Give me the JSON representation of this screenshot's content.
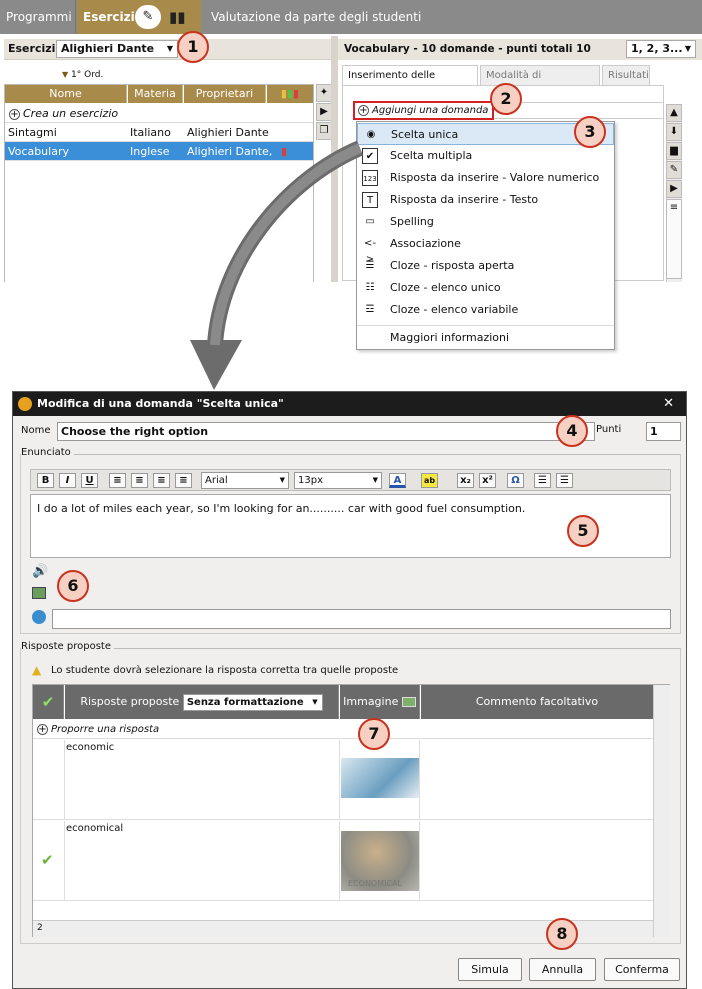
{
  "topbar": {
    "programmi": "Programmi",
    "esercizi": "Esercizi",
    "valutazione": "Valutazione da parte degli studenti"
  },
  "left": {
    "label": "Esercizi",
    "teacher": "Alighieri Dante",
    "level": "1° Ord.",
    "columns": [
      "Nome",
      "Materia",
      "Proprietari"
    ],
    "create": "Crea un esercizio",
    "rows": [
      {
        "nome": "Sintagmi",
        "materia": "Italiano",
        "proprietari": "Alighieri Dante"
      },
      {
        "nome": "Vocabulary",
        "materia": "Inglese",
        "proprietari": "Alighieri Dante,"
      }
    ]
  },
  "right": {
    "title": "Vocabulary - 10 domande - punti totali 10",
    "range": "1, 2, 3...",
    "tabs": [
      "Inserimento delle domande",
      "Modalità di esecuzione",
      "Risultati"
    ],
    "add": "Aggiungi una domanda",
    "menu": [
      "Scelta unica",
      "Scelta multipla",
      "Risposta da inserire - Valore numerico",
      "Risposta da inserire - Testo",
      "Spelling",
      "Associazione",
      "Cloze - risposta aperta",
      "Cloze - elenco unico",
      "Cloze - elenco variabile",
      "Maggiori informazioni"
    ]
  },
  "callouts": [
    "1",
    "2",
    "3",
    "4",
    "5",
    "6",
    "7",
    "8"
  ],
  "dialog": {
    "title": "Modifica di una domanda \"Scelta unica\"",
    "nome_label": "Nome",
    "nome_value": "Choose the right option",
    "punti_label": "Punti",
    "punti_value": "1",
    "enunciato_label": "Enunciato",
    "font": "Arial",
    "size": "13px",
    "text": "I do a lot of miles each year, so I'm looking for an..........  car with good fuel consumption.",
    "risposte_label": "Risposte proposte",
    "warning": "Lo studente dovrà selezionare la risposta corretta tra quelle proposte",
    "col_risposte": "Risposte proposte",
    "formatting": "Senza formattazione",
    "col_immagine": "Immagine",
    "col_commento": "Commento facoltativo",
    "proporre": "Proporre una risposta",
    "answers": [
      {
        "text": "economic",
        "correct": false
      },
      {
        "text": "economical",
        "correct": true
      }
    ],
    "image_caption": "ECONOMICAL",
    "page": "2",
    "buttons": {
      "simula": "Simula",
      "annulla": "Annulla",
      "conferma": "Conferma"
    }
  },
  "colors": {
    "accent": "#a88a4a",
    "callout_border": "#c8321e",
    "selection": "#3b8fd8",
    "correct": "#6bb53a"
  }
}
